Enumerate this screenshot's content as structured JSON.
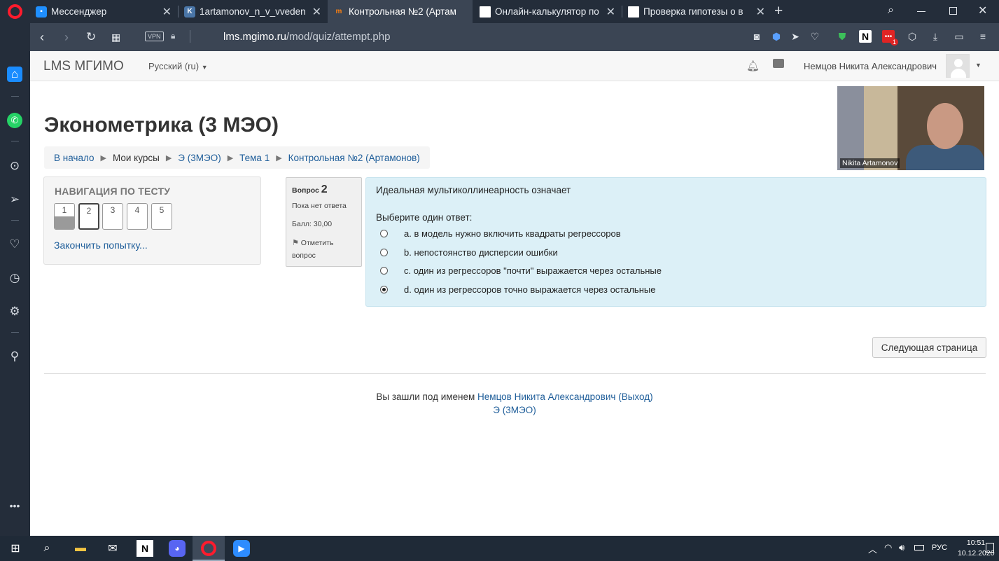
{
  "browser": {
    "tabs": [
      {
        "title": "Мессенджер",
        "icon": "messenger-icon",
        "color": "#1f8fff"
      },
      {
        "title": "1artamonov_n_v_vveden",
        "icon": "vk-icon",
        "color": "#4a76a8"
      },
      {
        "title": "Контрольная №2 (Артам",
        "icon": "moodle-icon",
        "color": "#f98012"
      },
      {
        "title": "Онлайн-калькулятор по",
        "icon": "page-icon",
        "color": "#ffffff"
      },
      {
        "title": "Проверка гипотезы о в",
        "icon": "page-icon",
        "color": "#ffffff"
      }
    ],
    "vpn_label": "VPN",
    "url_domain": "lms.mgimo.ru",
    "url_path": "/mod/quiz/attempt.php",
    "notion_badge": "1"
  },
  "header": {
    "site_name": "LMS МГИМО",
    "language": "Русский (ru)",
    "user_name": "Немцов Никита Александрович"
  },
  "page": {
    "title": "Эконометрика (3 МЭО)",
    "breadcrumb": [
      "В начало",
      "Мои курсы",
      "Э (3МЭО)",
      "Тема 1",
      "Контрольная №2 (Артамонов)"
    ]
  },
  "quiz_nav": {
    "heading": "НАВИГАЦИЯ ПО ТЕСТУ",
    "questions": [
      "1",
      "2",
      "3",
      "4",
      "5"
    ],
    "answered_question": "1",
    "current_question": "2",
    "finish_link": "Закончить попытку..."
  },
  "question_info": {
    "label": "Вопрос",
    "number": "2",
    "status": "Пока нет ответа",
    "grade": "Балл: 30,00",
    "flag_label": "Отметить",
    "flag_label2": "вопрос"
  },
  "question": {
    "text": "Идеальная мультиколлинеарность означает",
    "prompt": "Выберите один ответ:",
    "options": [
      {
        "label": "a. в модель нужно включить квадраты регрессоров",
        "selected": false
      },
      {
        "label": "b. непостоянство дисперсии ошибки",
        "selected": false
      },
      {
        "label": "c. один из регрессоров \"почти\" выражается через остальные",
        "selected": false
      },
      {
        "label": "d. один из регрессоров точно выражается через остальные",
        "selected": true
      }
    ]
  },
  "next_button": "Следующая страница",
  "footer": {
    "logged_in_prefix": "Вы зашли под именем ",
    "user_link": "Немцов Никита Александрович",
    "logout_link": "(Выход)",
    "course_link": "Э (3МЭО)"
  },
  "video_overlay": {
    "name": "Nikita Artamonov"
  },
  "taskbar": {
    "language": "РУС",
    "time": "10:51",
    "date": "10.12.2020"
  },
  "colors": {
    "link": "#1f5e9a",
    "question_bg": "#dcf0f7",
    "browser_dark": "#242d3a",
    "browser_bar": "#3b4554",
    "opera_red": "#ff1b2d"
  }
}
